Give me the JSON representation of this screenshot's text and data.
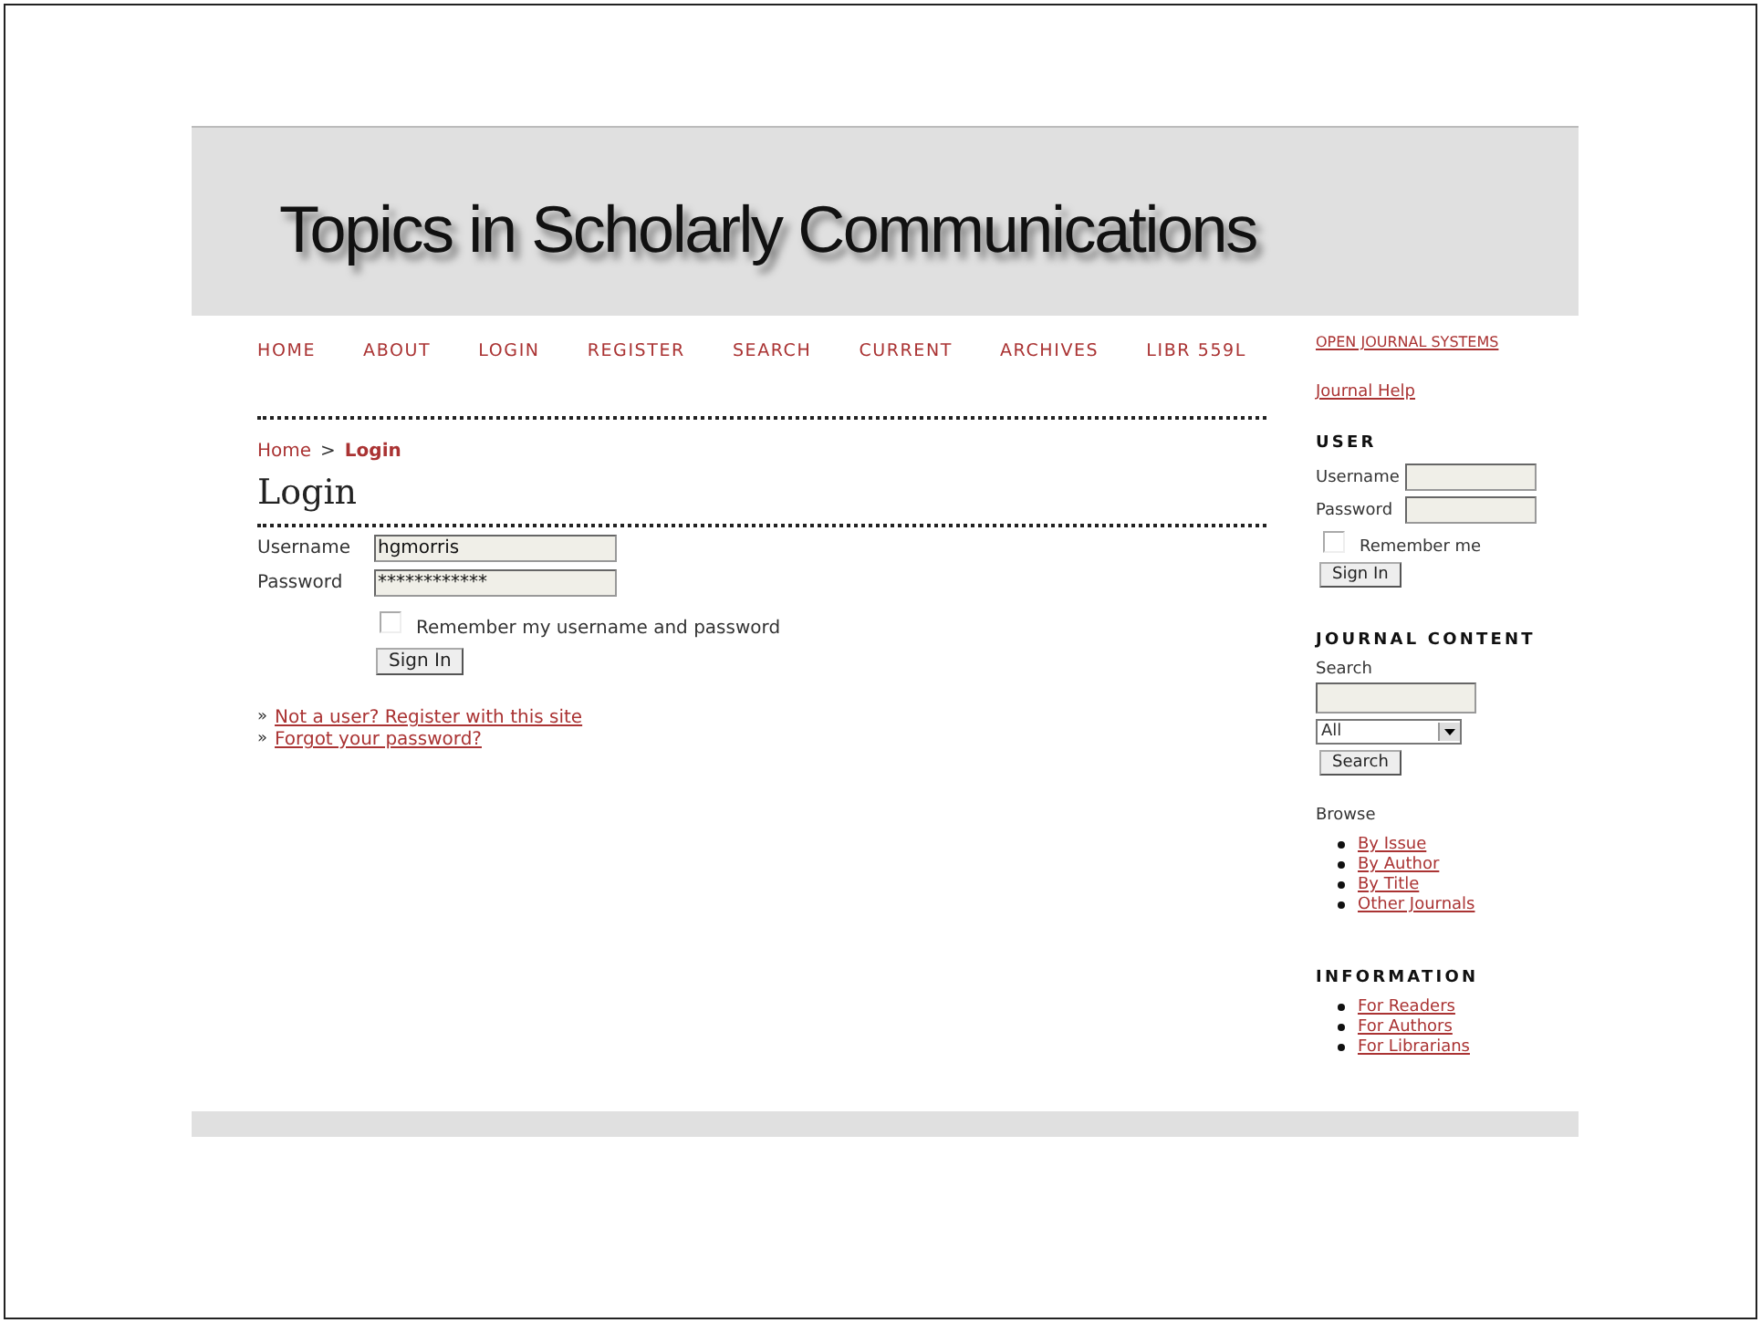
{
  "header": {
    "title": "Topics in Scholarly Communications"
  },
  "nav": [
    {
      "label": "HOME"
    },
    {
      "label": "ABOUT"
    },
    {
      "label": "LOGIN"
    },
    {
      "label": "REGISTER"
    },
    {
      "label": "SEARCH"
    },
    {
      "label": "CURRENT"
    },
    {
      "label": "ARCHIVES"
    },
    {
      "label": "LIBR 559L"
    }
  ],
  "breadcrumb": {
    "home": "Home",
    "separator": ">",
    "current": "Login"
  },
  "page_title": "Login",
  "login_form": {
    "username_label": "Username",
    "username_value": "hgmorris",
    "password_label": "Password",
    "password_value": "************",
    "remember_label": "Remember my username and password",
    "remember_checked": false,
    "button": "Sign In"
  },
  "links": [
    {
      "marker": "»",
      "label": "Not a user? Register with this site"
    },
    {
      "marker": "»",
      "label": "Forgot your password?"
    }
  ],
  "sidebar": {
    "top_links": [
      "OPEN JOURNAL SYSTEMS",
      "Journal Help"
    ],
    "user": {
      "heading": "USER",
      "username_label": "Username",
      "password_label": "Password",
      "remember_label": "Remember me",
      "remember_checked": false,
      "button": "Sign In"
    },
    "journal_content": {
      "heading": "JOURNAL CONTENT",
      "search_label": "Search",
      "scope_value": "All",
      "button": "Search",
      "browse_label": "Browse",
      "browse_links": [
        "By Issue",
        "By Author",
        "By Title",
        "Other Journals"
      ]
    },
    "information": {
      "heading": "INFORMATION",
      "links": [
        "For Readers",
        "For Authors",
        "For Librarians"
      ]
    }
  }
}
